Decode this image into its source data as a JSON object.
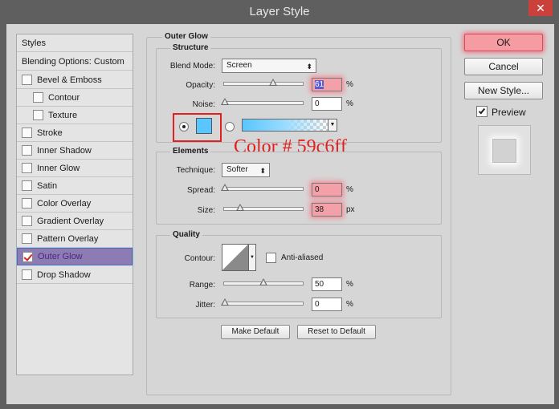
{
  "window": {
    "title": "Layer Style",
    "close_glyph": "✕"
  },
  "styles": {
    "header": "Styles",
    "blending": "Blending Options: Custom",
    "items": [
      {
        "label": "Bevel & Emboss",
        "checked": false
      },
      {
        "label": "Contour",
        "checked": false
      },
      {
        "label": "Texture",
        "checked": false
      },
      {
        "label": "Stroke",
        "checked": false
      },
      {
        "label": "Inner Shadow",
        "checked": false
      },
      {
        "label": "Inner Glow",
        "checked": false
      },
      {
        "label": "Satin",
        "checked": false
      },
      {
        "label": "Color Overlay",
        "checked": false
      },
      {
        "label": "Gradient Overlay",
        "checked": false
      },
      {
        "label": "Pattern Overlay",
        "checked": false
      },
      {
        "label": "Outer Glow",
        "checked": true
      },
      {
        "label": "Drop Shadow",
        "checked": false
      }
    ]
  },
  "outer_glow": {
    "section": "Outer Glow",
    "structure": {
      "title": "Structure",
      "blend_mode_label": "Blend Mode:",
      "blend_mode": "Screen",
      "opacity_label": "Opacity:",
      "opacity": "61",
      "noise_label": "Noise:",
      "noise": "0",
      "unit_percent": "%",
      "color_hex": "#59c6ff"
    },
    "annotation": "Color # 59c6ff",
    "elements": {
      "title": "Elements",
      "technique_label": "Technique:",
      "technique": "Softer",
      "spread_label": "Spread:",
      "spread": "0",
      "size_label": "Size:",
      "size": "38",
      "unit_px": "px",
      "unit_percent": "%"
    },
    "quality": {
      "title": "Quality",
      "contour_label": "Contour:",
      "anti_aliased_label": "Anti-aliased",
      "range_label": "Range:",
      "range": "50",
      "jitter_label": "Jitter:",
      "jitter": "0",
      "unit_percent": "%"
    },
    "make_default": "Make Default",
    "reset_default": "Reset to Default"
  },
  "actions": {
    "ok": "OK",
    "cancel": "Cancel",
    "new_style": "New Style...",
    "preview": "Preview"
  },
  "colors": {
    "accent_red": "#e12020",
    "glow": "#59c6ff"
  }
}
